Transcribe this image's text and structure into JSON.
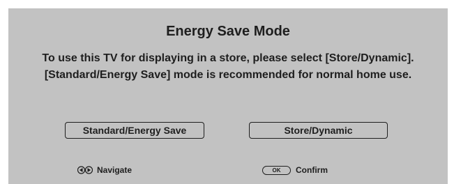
{
  "dialog": {
    "title": "Energy Save Mode",
    "message_line1": "To use this TV for displaying in a store, please select [Store/Dynamic].",
    "message_line2": "[Standard/Energy Save] mode is recommended for normal home use."
  },
  "buttons": {
    "standard_label": "Standard/Energy Save",
    "store_label": "Store/Dynamic"
  },
  "hints": {
    "navigate_icon": "left-right-arrows-icon",
    "navigate_label": "Navigate",
    "confirm_icon_text": "OK",
    "confirm_label": "Confirm"
  },
  "colors": {
    "panel_background": "#c2c2c2",
    "text": "#1e1e1e"
  }
}
